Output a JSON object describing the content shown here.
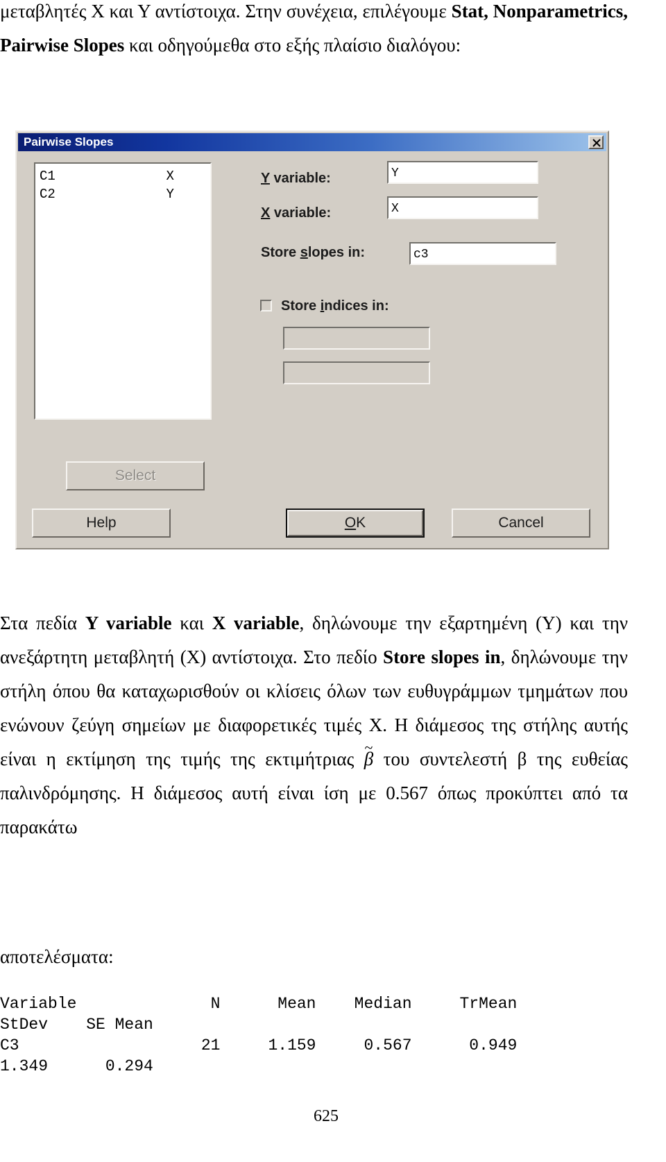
{
  "document": {
    "page_number": "625",
    "paragraph_top": {
      "line1_a": "μεταβλητές Χ και Υ αντίστοιχα. Στην συνέχεια, επιλέγουμε ",
      "line1_bold": "Stat,",
      "line2_bold": "Nonparametrics, Pairwise Slopes",
      "line2_b": " και οδηγούμεθα στο εξής πλαίσιο",
      "line3": "διαλόγου:"
    },
    "paragraph_mid": {
      "s1": "Στα πεδία ",
      "b1": "Y variable",
      "s2": " και ",
      "b2": "X variable",
      "s3": ", δηλώνουμε την εξαρτημένη (Υ) και την ανεξάρτητη μεταβλητή (Χ) αντίστοιχα. Στο πεδίο ",
      "b3": "Store slopes in",
      "s4": ", δηλώνουμε την στήλη όπου θα καταχωρισθούν οι κλίσεις όλων των ευθυγράμμων τμημάτων που ενώνουν ζεύγη σημείων με διαφορετικές τιμές Χ. Η διάμεσος της στήλης αυτής είναι η εκτίμηση της τιμής της εκτιμήτριας ",
      "beta_symbol": "β",
      "s5": " του συντελεστή β της ευθείας παλινδρόμησης. Η διάμεσος αυτή είναι ίση με 0.567 όπως προκύπτει από τα παρακάτω"
    },
    "paragraph_end": {
      "text": "αποτελέσματα:"
    }
  },
  "dialog": {
    "title": "Pairwise Slopes",
    "close_icon": "close-icon",
    "variable_list": [
      {
        "column": "C1",
        "name": "X"
      },
      {
        "column": "C2",
        "name": "Y"
      }
    ],
    "fields": {
      "y_variable": {
        "label_accel": "Y",
        "label_rest": " variable:",
        "value": "Y"
      },
      "x_variable": {
        "label_accel": "X",
        "label_rest": " variable:",
        "value": "X"
      },
      "store_slopes": {
        "label_pre": "Store ",
        "label_accel": "s",
        "label_rest": "lopes in:",
        "value": "c3"
      },
      "store_indices": {
        "label_pre": "Store ",
        "label_accel": "i",
        "label_rest": "ndices in:",
        "checked": false,
        "value1": "",
        "value2": ""
      }
    },
    "buttons": {
      "select": {
        "label": "Select",
        "enabled": false
      },
      "help": {
        "label": "Help",
        "enabled": true
      },
      "ok": {
        "label_accel": "O",
        "label_rest": "K",
        "default": true
      },
      "cancel": {
        "label": "Cancel",
        "enabled": true
      }
    }
  },
  "output": {
    "line1": "Variable              N      Mean    Median     TrMean",
    "line2": "StDev    SE Mean",
    "line3": "C3                   21     1.159     0.567      0.949",
    "line4": "1.349      0.294"
  }
}
